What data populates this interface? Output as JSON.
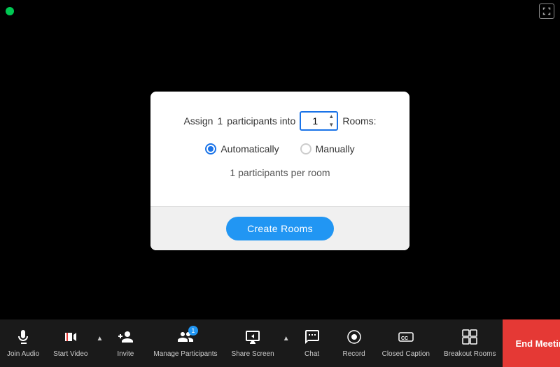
{
  "topbar": {
    "green_dot_label": "recording-indicator"
  },
  "dialog": {
    "assign_prefix": "Assign",
    "participant_count": "1",
    "assign_middle": "participants into",
    "rooms_suffix": "Rooms:",
    "room_number_value": "1",
    "radio_automatically": "Automatically",
    "radio_manually": "Manually",
    "per_room_text": "1 participants per room",
    "create_rooms_label": "Create Rooms"
  },
  "toolbar": {
    "join_audio_label": "Join Audio",
    "start_video_label": "Start Video",
    "invite_label": "Invite",
    "manage_participants_label": "Manage Participants",
    "manage_participants_badge": "1",
    "share_screen_label": "Share Screen",
    "chat_label": "Chat",
    "record_label": "Record",
    "closed_caption_label": "Closed Caption",
    "breakout_rooms_label": "Breakout Rooms",
    "end_meeting_label": "End Meeting"
  }
}
